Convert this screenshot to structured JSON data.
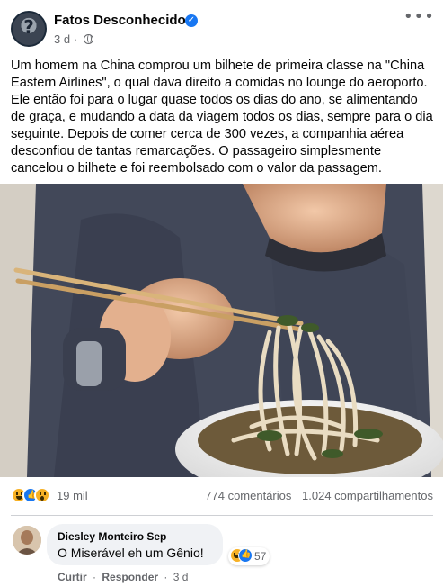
{
  "post": {
    "page_name": "Fatos Desconhecidos",
    "time": "3 d",
    "meta_sep": "·",
    "more_label": "•••",
    "avatar_glyph": "?",
    "verified_glyph": "✓",
    "text_lines": [
      "Um homem na China comprou um bilhete de primeira classe na \"China",
      "Eastern Airlines\", o qual dava direito a comidas no lounge do aeroporto.",
      "Ele então foi para o lugar quase todos os dias do ano, se alimentando",
      "de graça, e mudando a data da viagem todos os dias, sempre para o dia",
      "seguinte. Depois de comer cerca de 300 vezes, a companhia aérea",
      "desconfiou de tantas remarcações. O passageiro simplesmente",
      "cancelou o bilhete e foi reembolsado com o valor da passagem."
    ],
    "image_subject": "man-eating-noodles-with-chopsticks",
    "reactions": {
      "icons": [
        "haha",
        "like",
        "wow"
      ],
      "count": "19 mil",
      "comments": "774 comentários",
      "shares": "1.024 compartilhamentos"
    }
  },
  "comment": {
    "author": "Diesley Monteiro Sep",
    "text": "O Miserável eh um Gênio!",
    "reaction_icons": [
      "haha",
      "like"
    ],
    "reaction_count": "57",
    "actions": {
      "like": "Curtir",
      "separator": "·",
      "reply": "Responder",
      "time": "3 d"
    }
  },
  "colors": {
    "brand_blue": "#1877f2",
    "secondary_text": "#65676b",
    "bubble_bg": "#f0f2f5",
    "reaction_yellow": "#f7b125"
  }
}
